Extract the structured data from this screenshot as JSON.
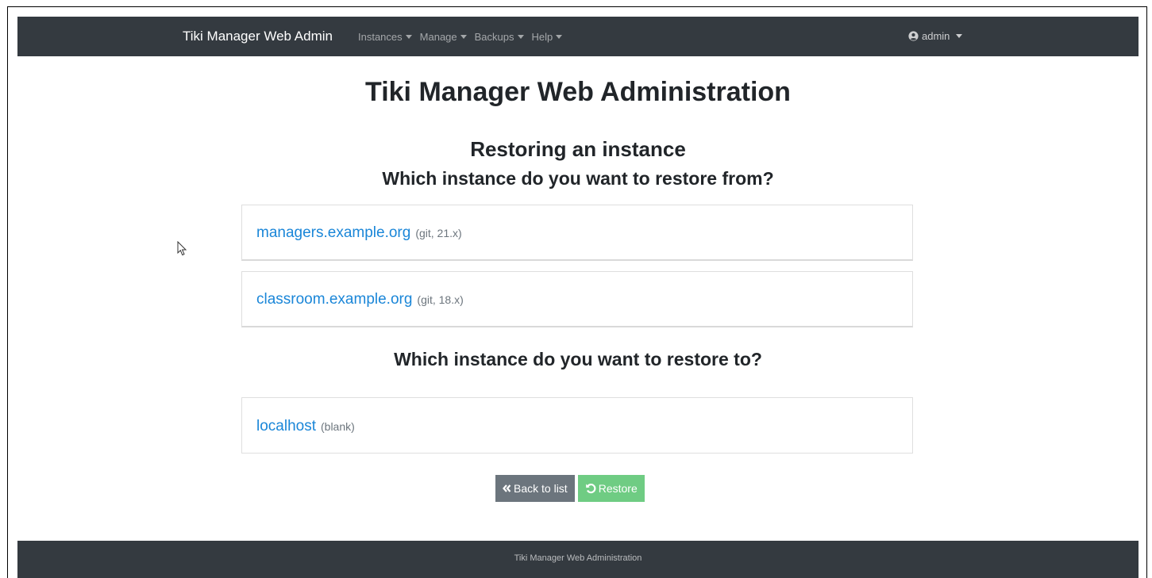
{
  "navbar": {
    "brand": "Tiki Manager Web Admin",
    "menu": [
      {
        "label": "Instances"
      },
      {
        "label": "Manage"
      },
      {
        "label": "Backups"
      },
      {
        "label": "Help"
      }
    ],
    "user": "admin"
  },
  "main": {
    "title": "Tiki Manager Web Administration",
    "subtitle": "Restoring an instance",
    "question_from": "Which instance do you want to restore from?",
    "source_instances": [
      {
        "name": "managers.example.org",
        "meta": "(git, 21.x)"
      },
      {
        "name": "classroom.example.org",
        "meta": "(git, 18.x)"
      }
    ],
    "question_to": "Which instance do you want to restore to?",
    "target_instances": [
      {
        "name": "localhost",
        "meta": "(blank)"
      }
    ],
    "back_button": "Back to list",
    "restore_button": "Restore"
  },
  "footer": {
    "text": "Tiki Manager Web Administration"
  },
  "colors": {
    "navbar": "#343a40",
    "link": "#1a86d8",
    "secondary": "#6c757d",
    "success": "#6fcc83"
  }
}
